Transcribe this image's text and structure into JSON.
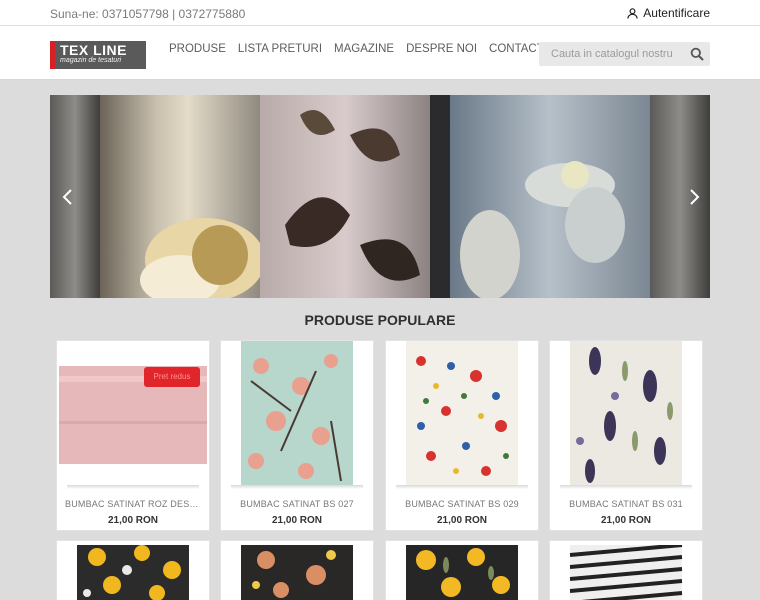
{
  "topbar": {
    "phone": "Suna-ne: 0371057798 | 0372775880",
    "login": "Autentificare"
  },
  "logo": {
    "title": "TEX LINE",
    "subtitle": "magazin de tesaturi"
  },
  "nav": {
    "items": [
      "PRODUSE",
      "LISTA PRETURI",
      "MAGAZINE",
      "DESPRE NOI",
      "CONTACT"
    ]
  },
  "search": {
    "placeholder": "Cauta in catalogul nostru"
  },
  "section": {
    "title": "PRODUSE POPULARE"
  },
  "products": [
    {
      "name": "BUMBAC SATINAT ROZ DESCHIS",
      "price": "21,00 RON",
      "badge": "Pret redus"
    },
    {
      "name": "BUMBAC SATINAT BS 027",
      "price": "21,00 RON"
    },
    {
      "name": "BUMBAC SATINAT BS 029",
      "price": "21,00 RON"
    },
    {
      "name": "BUMBAC SATINAT BS 031",
      "price": "21,00 RON"
    }
  ],
  "colors": {
    "brand_red": "#d71f26",
    "logo_grey": "#5a5a5a",
    "page_bg": "#dcdcdc"
  },
  "icons": {
    "login": "user-icon",
    "search": "search-icon",
    "prev": "chevron-left-icon",
    "next": "chevron-right-icon"
  }
}
